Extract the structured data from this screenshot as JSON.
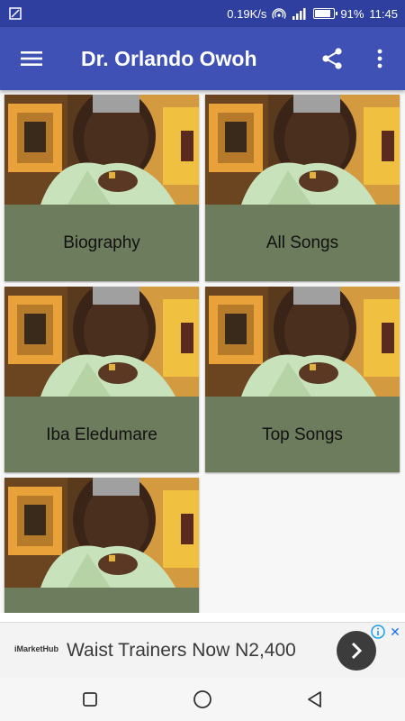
{
  "status_bar": {
    "speed": "0.19K/s",
    "battery_percent": "91%",
    "battery_level": 0.91,
    "time": "11:45",
    "icons": [
      "screenshot-icon",
      "hotspot-icon",
      "signal-icon",
      "battery-icon"
    ]
  },
  "app_bar": {
    "title": "Dr. Orlando Owoh",
    "icons": [
      "menu-icon",
      "share-icon",
      "more-vert-icon"
    ],
    "color": "#3f51b5"
  },
  "grid": {
    "items": [
      {
        "label": "Biography"
      },
      {
        "label": "All Songs"
      },
      {
        "label": "Iba Eledumare"
      },
      {
        "label": "Top Songs"
      },
      {
        "label": ""
      }
    ],
    "card_color": "#6d7c5d"
  },
  "ad": {
    "brand": "iMarketHub",
    "text": "Waist Trainers Now N2,400",
    "close": "✕",
    "icons": [
      "ad-info-icon",
      "ad-close-icon",
      "chevron-right-icon"
    ]
  },
  "nav_bar": {
    "icons": [
      "recents-icon",
      "home-icon",
      "back-icon"
    ]
  }
}
